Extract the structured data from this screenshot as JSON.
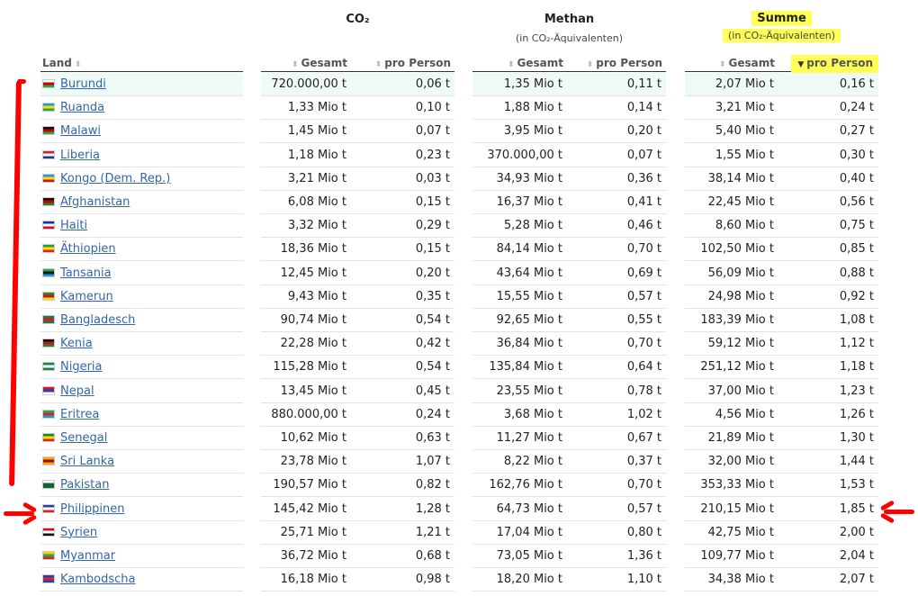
{
  "groups": {
    "co2": {
      "title": "CO₂",
      "subtitle": ""
    },
    "methan": {
      "title": "Methan",
      "subtitle": "(in CO₂-Äquivalenten)"
    },
    "summe": {
      "title": "Summe",
      "subtitle": "(in CO₂-Äquivalenten)"
    }
  },
  "columns": {
    "land": "Land",
    "gesamt": "Gesamt",
    "pro_person": "pro Person"
  },
  "sort_icons": {
    "inactive": "⬍",
    "active": "▼"
  },
  "rows": [
    {
      "land": "Burundi",
      "flag": [
        "#ffffff",
        "#cc0000",
        "#22aa44"
      ],
      "co2_g": "720.000,00 t",
      "co2_p": "0,06 t",
      "m_g": "1,35 Mio t",
      "m_p": "0,11 t",
      "s_g": "2,07 Mio t",
      "s_p": "0,16 t"
    },
    {
      "land": "Ruanda",
      "flag": [
        "#2299dd",
        "#ffdd00",
        "#22aa44"
      ],
      "co2_g": "1,33 Mio t",
      "co2_p": "0,10 t",
      "m_g": "1,88 Mio t",
      "m_p": "0,14 t",
      "s_g": "3,21 Mio t",
      "s_p": "0,24 t"
    },
    {
      "land": "Malawi",
      "flag": [
        "#111111",
        "#cc0000",
        "#22aa44"
      ],
      "co2_g": "1,45 Mio t",
      "co2_p": "0,07 t",
      "m_g": "3,95 Mio t",
      "m_p": "0,20 t",
      "s_g": "5,40 Mio t",
      "s_p": "0,27 t"
    },
    {
      "land": "Liberia",
      "flag": [
        "#cc2233",
        "#ffffff",
        "#223388"
      ],
      "co2_g": "1,18 Mio t",
      "co2_p": "0,23 t",
      "m_g": "370.000,00 t",
      "m_p": "0,07 t",
      "s_g": "1,55 Mio t",
      "s_p": "0,30 t"
    },
    {
      "land": "Kongo (Dem. Rep.)",
      "flag": [
        "#2299ee",
        "#ffdd00",
        "#cc1122"
      ],
      "co2_g": "3,21 Mio t",
      "co2_p": "0,03 t",
      "m_g": "34,93 Mio t",
      "m_p": "0,36 t",
      "s_g": "38,14 Mio t",
      "s_p": "0,40 t"
    },
    {
      "land": "Afghanistan",
      "flag": [
        "#111111",
        "#cc0000",
        "#228833"
      ],
      "co2_g": "6,08 Mio t",
      "co2_p": "0,15 t",
      "m_g": "16,37 Mio t",
      "m_p": "0,41 t",
      "s_g": "22,45 Mio t",
      "s_p": "0,56 t"
    },
    {
      "land": "Haiti",
      "flag": [
        "#1133aa",
        "#ffffff",
        "#cc1122"
      ],
      "co2_g": "3,32 Mio t",
      "co2_p": "0,29 t",
      "m_g": "5,28 Mio t",
      "m_p": "0,46 t",
      "s_g": "8,60 Mio t",
      "s_p": "0,75 t"
    },
    {
      "land": "Äthiopien",
      "flag": [
        "#229944",
        "#ffdd00",
        "#dd2222"
      ],
      "co2_g": "18,36 Mio t",
      "co2_p": "0,15 t",
      "m_g": "84,14 Mio t",
      "m_p": "0,70 t",
      "s_g": "102,50 Mio t",
      "s_p": "0,85 t"
    },
    {
      "land": "Tansania",
      "flag": [
        "#22aa44",
        "#111111",
        "#2299dd"
      ],
      "co2_g": "12,45 Mio t",
      "co2_p": "0,20 t",
      "m_g": "43,64 Mio t",
      "m_p": "0,69 t",
      "s_g": "56,09 Mio t",
      "s_p": "0,88 t"
    },
    {
      "land": "Kamerun",
      "flag": [
        "#228833",
        "#cc1122",
        "#ffdd00"
      ],
      "co2_g": "9,43 Mio t",
      "co2_p": "0,35 t",
      "m_g": "15,55 Mio t",
      "m_p": "0,57 t",
      "s_g": "24,98 Mio t",
      "s_p": "0,92 t"
    },
    {
      "land": "Bangladesch",
      "flag": [
        "#227744",
        "#cc2222",
        "#227744"
      ],
      "co2_g": "90,74 Mio t",
      "co2_p": "0,54 t",
      "m_g": "92,65 Mio t",
      "m_p": "0,55 t",
      "s_g": "183,39 Mio t",
      "s_p": "1,08 t"
    },
    {
      "land": "Kenia",
      "flag": [
        "#111111",
        "#cc1122",
        "#228833"
      ],
      "co2_g": "22,28 Mio t",
      "co2_p": "0,42 t",
      "m_g": "36,84 Mio t",
      "m_p": "0,70 t",
      "s_g": "59,12 Mio t",
      "s_p": "1,12 t"
    },
    {
      "land": "Nigeria",
      "flag": [
        "#118844",
        "#ffffff",
        "#118844"
      ],
      "co2_g": "115,28 Mio t",
      "co2_p": "0,54 t",
      "m_g": "135,84 Mio t",
      "m_p": "0,64 t",
      "s_g": "251,12 Mio t",
      "s_p": "1,18 t"
    },
    {
      "land": "Nepal",
      "flag": [
        "#dd1133",
        "#2244aa",
        "#ffffff"
      ],
      "co2_g": "13,45 Mio t",
      "co2_p": "0,45 t",
      "m_g": "23,55 Mio t",
      "m_p": "0,78 t",
      "s_g": "37,00 Mio t",
      "s_p": "1,23 t"
    },
    {
      "land": "Eritrea",
      "flag": [
        "#22aa44",
        "#dd2222",
        "#2299dd"
      ],
      "co2_g": "880.000,00 t",
      "co2_p": "0,24 t",
      "m_g": "3,68 Mio t",
      "m_p": "1,02 t",
      "s_g": "4,56 Mio t",
      "s_p": "1,26 t"
    },
    {
      "land": "Senegal",
      "flag": [
        "#118844",
        "#ffdd00",
        "#dd2222"
      ],
      "co2_g": "10,62 Mio t",
      "co2_p": "0,63 t",
      "m_g": "11,27 Mio t",
      "m_p": "0,67 t",
      "s_g": "21,89 Mio t",
      "s_p": "1,30 t"
    },
    {
      "land": "Sri Lanka",
      "flag": [
        "#ffaa00",
        "#881122",
        "#ffaa00"
      ],
      "co2_g": "23,78 Mio t",
      "co2_p": "1,07 t",
      "m_g": "8,22 Mio t",
      "m_p": "0,37 t",
      "s_g": "32,00 Mio t",
      "s_p": "1,44 t"
    },
    {
      "land": "Pakistan",
      "flag": [
        "#ffffff",
        "#116633",
        "#116633"
      ],
      "co2_g": "190,57 Mio t",
      "co2_p": "0,82 t",
      "m_g": "162,76 Mio t",
      "m_p": "0,70 t",
      "s_g": "353,33 Mio t",
      "s_p": "1,53 t"
    },
    {
      "land": "Philippinen",
      "flag": [
        "#2244aa",
        "#ffffff",
        "#dd2233"
      ],
      "co2_g": "145,42 Mio t",
      "co2_p": "1,28 t",
      "m_g": "64,73 Mio t",
      "m_p": "0,57 t",
      "s_g": "210,15 Mio t",
      "s_p": "1,85 t"
    },
    {
      "land": "Syrien",
      "flag": [
        "#cc1122",
        "#ffffff",
        "#111111"
      ],
      "co2_g": "25,71 Mio t",
      "co2_p": "1,21 t",
      "m_g": "17,04 Mio t",
      "m_p": "0,80 t",
      "s_g": "42,75 Mio t",
      "s_p": "2,00 t"
    },
    {
      "land": "Myanmar",
      "flag": [
        "#ffcc00",
        "#22aa44",
        "#dd2222"
      ],
      "co2_g": "36,72 Mio t",
      "co2_p": "0,68 t",
      "m_g": "73,05 Mio t",
      "m_p": "1,36 t",
      "s_g": "109,77 Mio t",
      "s_p": "2,04 t"
    },
    {
      "land": "Kambodscha",
      "flag": [
        "#2244aa",
        "#dd2233",
        "#2244aa"
      ],
      "co2_g": "16,18 Mio t",
      "co2_p": "0,98 t",
      "m_g": "18,20 Mio t",
      "m_p": "1,10 t",
      "s_g": "34,38 Mio t",
      "s_p": "2,07 t"
    }
  ],
  "highlight_color": "#ffff55",
  "annotation_color": "#ff0000"
}
